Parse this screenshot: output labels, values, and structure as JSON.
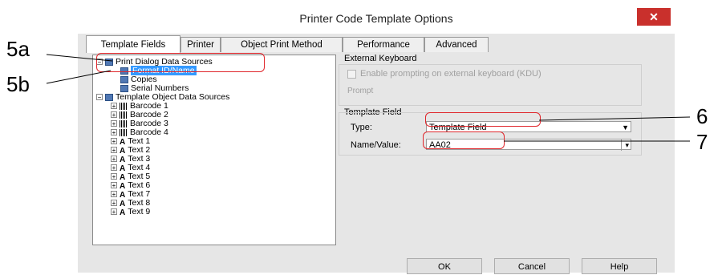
{
  "dialog": {
    "title": "Printer Code Template Options",
    "close_glyph": "✕"
  },
  "tabs": [
    {
      "label": "Template Fields",
      "active": true
    },
    {
      "label": "Printer",
      "active": false
    },
    {
      "label": "Object Print Method",
      "active": false
    },
    {
      "label": "Performance",
      "active": false
    },
    {
      "label": "Advanced",
      "active": false
    }
  ],
  "tree": {
    "print_dialog": {
      "label": "Print Dialog Data Sources",
      "children": [
        "Format ID/Name",
        "Copies",
        "Serial Numbers"
      ]
    },
    "template_objects": {
      "label": "Template Object Data Sources",
      "barcodes": [
        "Barcode 1",
        "Barcode 2",
        "Barcode 3",
        "Barcode 4"
      ],
      "texts": [
        "Text 1",
        "Text 2",
        "Text 3",
        "Text 4",
        "Text 5",
        "Text 6",
        "Text 7",
        "Text 8",
        "Text 9"
      ]
    }
  },
  "external_keyboard": {
    "heading": "External Keyboard",
    "checkbox_label": "Enable prompting on external keyboard (KDU)",
    "prompt_label": "Prompt"
  },
  "template_field": {
    "heading": "Template Field",
    "type_label": "Type:",
    "type_value": "Template Field",
    "name_label": "Name/Value:",
    "name_value": "AA02"
  },
  "buttons": {
    "ok": "OK",
    "cancel": "Cancel",
    "help": "Help"
  },
  "callouts": {
    "c5a": "5a",
    "c5b": "5b",
    "c6": "6",
    "c7": "7"
  },
  "colors": {
    "callout_oval": "#e0262b",
    "selection": "#3399ff",
    "close_button": "#c9302c"
  }
}
